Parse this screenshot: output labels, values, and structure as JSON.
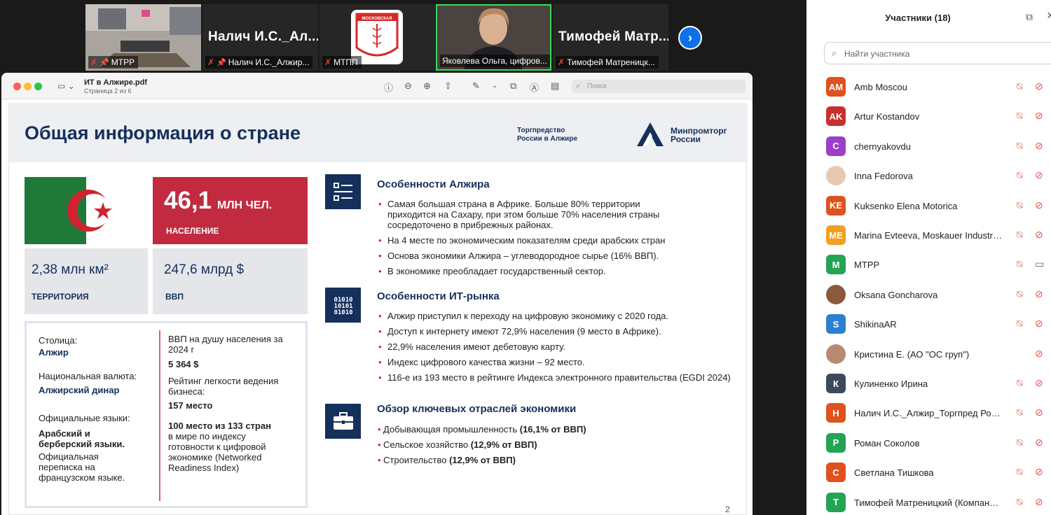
{
  "video_tiles": [
    {
      "label": "МТРР",
      "pinned": true
    },
    {
      "big_name": "Налич  И.С._Ал...",
      "label": "Налич И.С._Алжир...",
      "pinned": true
    },
    {
      "label": "МТПП",
      "pinned": false
    },
    {
      "label": "Яковлева Ольга, цифров...",
      "pinned": false,
      "active_speaker": true
    },
    {
      "big_name": "Тимофей  Матр...",
      "label": "Тимофей Матреницк...",
      "pinned": false
    }
  ],
  "mtpp_logo": {
    "line1": "МОСКОВСКАЯ"
  },
  "pdf": {
    "file_name": "ИТ в Алжире.pdf",
    "page_info": "Страница 2 из 6",
    "search_placeholder": "Поиск"
  },
  "slide": {
    "title": "Общая информация о стране",
    "trade_rep": "Торгпредство\nРоссии в Алжире",
    "minprom": "Минпромторг\nРоссии",
    "population": {
      "value": "46,1",
      "unit": "МЛН ЧЕЛ.",
      "label": "НАСЕЛЕНИЕ"
    },
    "territory": {
      "value": "2,38 млн км²",
      "label": "ТЕРРИТОРИЯ"
    },
    "gdp": {
      "value": "247,6 млрд $",
      "label": "ВВП"
    },
    "info": {
      "capital_label": "Столица:",
      "capital_value": "Алжир",
      "currency_label": "Национальная валюта:",
      "currency_value": "Алжирский динар",
      "languages_label": "Официальные языки:",
      "languages_value": "Арабский и берберский языки.",
      "languages_note": "Официальная переписка на французском языке.",
      "gdp_per_capita_label": "ВВП на душу населения за 2024 г",
      "gdp_per_capita_value": "5 364 $",
      "ease_label": "Рейтинг легкости ведения бизнеса:",
      "ease_value": "157 место",
      "nri_value": "100 место из 133 стран",
      "nri_note": "в мире по индексу готовности к цифровой экономике (Networked Readiness Index)"
    },
    "sections": [
      {
        "title": "Особенности Алжира",
        "items": [
          "Самая большая страна в Африке. Больше 80% территории приходится на Сахару, при этом больше 70% населения страны сосредоточено в прибрежных районах.",
          "На 4 месте по экономическим показателям среди арабских стран",
          "Основа экономики Алжира – углеводородное сырье (16% ВВП).",
          "В экономике преобладает государственный сектор."
        ]
      },
      {
        "title": "Особенности ИТ-рынка",
        "items": [
          "Алжир приступил к переходу на цифровую экономику с 2020 года.",
          "Доступ к интернету имеют 72,9% населения (9 место в Африке).",
          "22,9% населения имеют дебетовую карту.",
          "Индекс цифрового качества жизни – 92 место.",
          "116-е из 193 место в рейтинге Индекса электронного правительства (EGDI 2024)"
        ]
      },
      {
        "title": "Обзор ключевых отраслей экономики",
        "items": [
          {
            "text": "Добывающая промышленность ",
            "bold": "(16,1% от ВВП)"
          },
          {
            "text": "Сельское хозяйство ",
            "bold": "(12,9% от ВВП)"
          },
          {
            "text": "Строительство ",
            "bold": "(12,9% от ВВП)"
          }
        ]
      }
    ],
    "page_number": "2"
  },
  "participants": {
    "title": "Участники (18)",
    "search_placeholder": "Найти участника",
    "list": [
      {
        "initials": "AM",
        "name": "Amb Moscou",
        "color": "#e0521d",
        "mic": "off",
        "cam": "off"
      },
      {
        "initials": "AK",
        "name": "Artur Kostandov",
        "color": "#c8302f",
        "mic": "off",
        "cam": "off"
      },
      {
        "initials": "C",
        "name": "chernyakovdu",
        "color": "#9b3fc8",
        "mic": "off",
        "cam": "off"
      },
      {
        "initials": "",
        "name": "Inna Fedorova",
        "color": "#e8c9b0",
        "photo": true,
        "mic": "off",
        "cam": "off"
      },
      {
        "initials": "KE",
        "name": "Kuksenko Elena Motorica",
        "color": "#e0521d",
        "mic": "off",
        "cam": "off"
      },
      {
        "initials": "ME",
        "name": "Marina Evteeva, Moskauer Industrie u...",
        "color": "#f0a020",
        "mic": "off",
        "cam": "off"
      },
      {
        "initials": "M",
        "name": "MTPP",
        "color": "#23a455",
        "mic": "off",
        "cam": "on"
      },
      {
        "initials": "",
        "name": "Oksana Goncharova",
        "color": "#8a5a3c",
        "photo": true,
        "mic": "off",
        "cam": "off"
      },
      {
        "initials": "S",
        "name": "ShikinaAR",
        "color": "#2d7fd3",
        "mic": "off",
        "cam": "off"
      },
      {
        "initials": "",
        "name": "Кристина Е. (АО \"ОС груп\")",
        "color": "#b88a70",
        "photo": true,
        "mic": "none",
        "cam": "off"
      },
      {
        "initials": "К",
        "name": "Кулиненко Ирина",
        "color": "#3c4a5c",
        "mic": "off",
        "cam": "off"
      },
      {
        "initials": "Н",
        "name": "Налич И.С._Алжир_Торгпред России",
        "color": "#e0521d",
        "mic": "off",
        "cam": "off"
      },
      {
        "initials": "Р",
        "name": "Роман Соколов",
        "color": "#23a455",
        "mic": "off",
        "cam": "off"
      },
      {
        "initials": "С",
        "name": "Светлана Тишкова",
        "color": "#e0521d",
        "mic": "off",
        "cam": "off"
      },
      {
        "initials": "Т",
        "name": "Тимофей Матреницкий (Компания \"...",
        "color": "#23a455",
        "mic": "off",
        "cam": "off"
      }
    ]
  }
}
